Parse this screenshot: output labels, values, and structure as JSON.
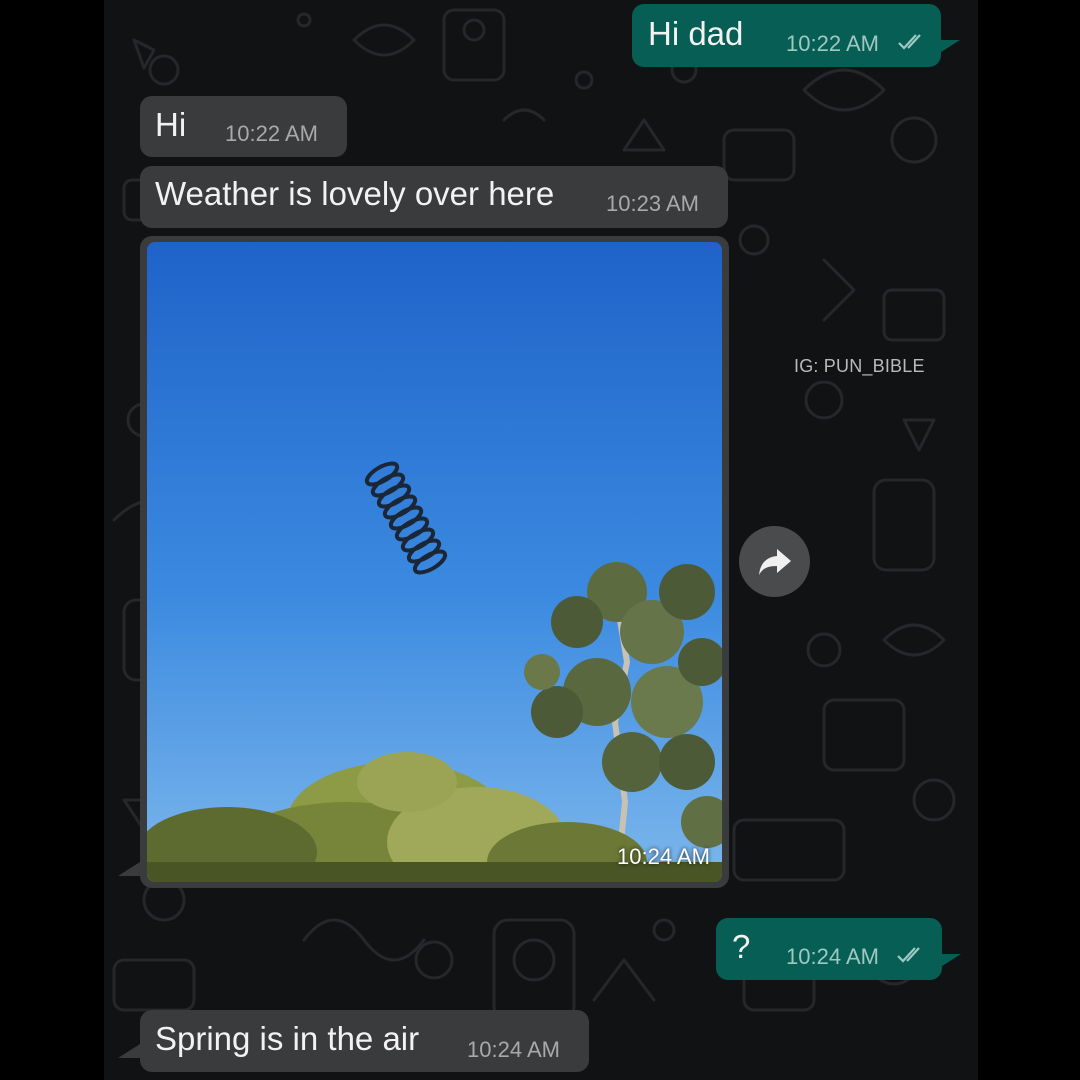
{
  "messages": [
    {
      "id": "m1",
      "direction": "out",
      "text": "Hi dad",
      "time": "10:22 AM",
      "status_icon": "double-check-icon"
    },
    {
      "id": "m2",
      "direction": "in",
      "text": "Hi",
      "time": "10:22 AM"
    },
    {
      "id": "m3",
      "direction": "in",
      "text": "Weather is lovely over here",
      "time": "10:23 AM"
    },
    {
      "id": "m4",
      "direction": "in",
      "type": "image",
      "image_subject": "photo of a metal spring flying in a blue sky above treetops",
      "time": "10:24 AM"
    },
    {
      "id": "m5",
      "direction": "out",
      "text": "?",
      "time": "10:24 AM",
      "status_icon": "double-check-icon"
    },
    {
      "id": "m6",
      "direction": "in",
      "text": "Spring is in the air",
      "time": "10:24 AM"
    }
  ],
  "watermark": "IG: PUN_BIBLE",
  "forward_button_icon": "forward-arrow-icon",
  "colors": {
    "incoming_bubble": "#3a3b3d",
    "outgoing_bubble": "#075e54",
    "chat_background": "#111214",
    "check_marks": "#9ec9c2"
  }
}
